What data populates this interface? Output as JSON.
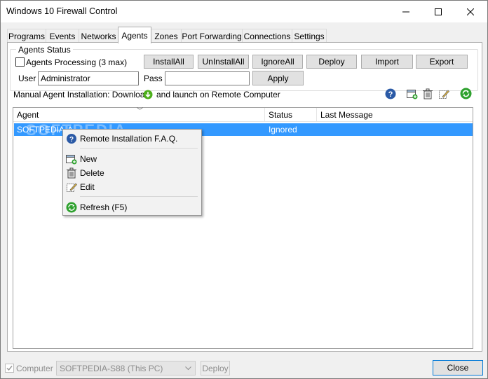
{
  "window": {
    "title": "Windows 10 Firewall Control"
  },
  "tabs": [
    "Programs",
    "Events",
    "Networks",
    "Agents",
    "Zones",
    "Port Forwarding",
    "Connections",
    "Settings"
  ],
  "active_tab": "Agents",
  "agents_status": {
    "legend": "Agents Status",
    "processing_label": "Agents Processing (3 max)",
    "processing_checked": false,
    "buttons": {
      "install_all": "InstallAll",
      "uninstall_all": "UnInstallAll",
      "ignore_all": "IgnoreAll",
      "deploy": "Deploy",
      "import": "Import",
      "export": "Export"
    },
    "user_label": "User",
    "user_value": "Administrator",
    "pass_label": "Pass",
    "pass_value": "",
    "apply_label": "Apply"
  },
  "manual_install": {
    "prefix": "Manual Agent Installation: Download",
    "suffix": "and launch on Remote Computer"
  },
  "grid": {
    "columns": [
      "Agent",
      "Status",
      "Last Message"
    ],
    "rows": [
      {
        "agent": "SOFTPEDIA-A",
        "status": "Ignored",
        "last_message": "",
        "selected": true
      }
    ]
  },
  "watermark": "SOFTPEDIA",
  "context_menu": {
    "items": [
      {
        "label": "Remote Installation F.A.Q.",
        "icon": "help-icon"
      },
      {
        "label": "New",
        "icon": "new-icon"
      },
      {
        "label": "Delete",
        "icon": "delete-icon"
      },
      {
        "label": "Edit",
        "icon": "edit-icon"
      },
      {
        "label": "Refresh (F5)",
        "icon": "refresh-icon"
      }
    ]
  },
  "bottom": {
    "computer_label": "Computer",
    "computer_checked": true,
    "computer_select": "SOFTPEDIA-S88 (This PC)",
    "deploy_label": "Deploy",
    "close_label": "Close"
  },
  "colors": {
    "selection": "#3399ff",
    "help_blue": "#2b5aa6",
    "refresh_green": "#2ea12e",
    "download_green": "#4caf1a"
  }
}
